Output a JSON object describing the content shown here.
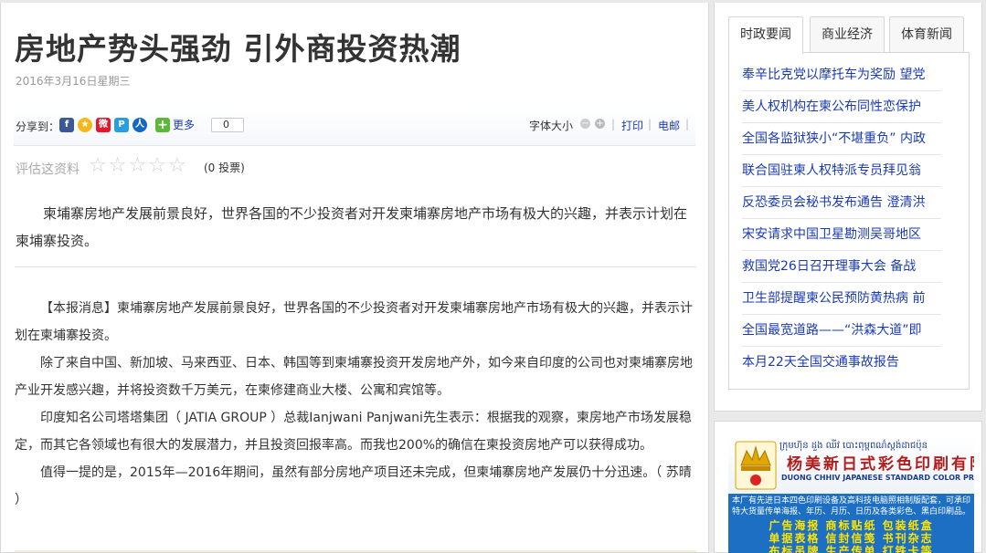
{
  "article": {
    "title": "房地产势头强劲 引外商投资热潮",
    "date": "2016年3月16日星期三",
    "share_label": "分享到：",
    "share_more": "更多",
    "share_count": "0",
    "font_size_label": "字体大小",
    "print_label": "打印",
    "email_label": "电邮",
    "rating_label": "评估这资料",
    "votes": "(0 投票)",
    "summary": "柬埔寨房地产发展前景良好，世界各国的不少投资者对开发柬埔寨房地产市场有极大的兴趣，并表示计划在柬埔寨投资。",
    "paragraphs": [
      "【本报消息】柬埔寨房地产发展前景良好，世界各国的不少投资者对开发柬埔寨房地产市场有极大的兴趣，并表示计划在柬埔寨投资。",
      "除了来自中国、新加坡、马来西亚、日本、韩国等到柬埔寨投资开发房地产外，如今来自印度的公司也对柬埔寨房地产业开发感兴趣，并将投资数千万美元，在柬修建商业大楼、公寓和宾馆等。",
      "印度知名公司塔塔集团（ JATIA GROUP ）总裁Ianjwani Panjwani先生表示：根据我的观察，柬房地产市场发展稳定，而其它各领域也有很大的发展潜力，并且投资回报率高。而我也200%的确信在柬投资房地产可以获得成功。",
      "值得一提的是，2015年—2016年期间，虽然有部分房地产项目还未完成，但柬埔寨房地产发展仍十分迅速。（ 苏晴 ）"
    ]
  },
  "sidebar": {
    "tabs": [
      "时政要闻",
      "商业经济",
      "体育新闻"
    ],
    "news": [
      "奉辛比克党以摩托车为奖励 望党",
      "美人权机构在柬公布同性恋保护",
      "全国各监狱狭小“不堪重负” 内政",
      "联合国驻柬人权特派专员拜见翁",
      "反恐委员会秘书发布通告 澄清洪",
      "宋安请求中国卫星勘测吴哥地区",
      "救国党26日召开理事大会 备战",
      "卫生部提醒柬公民预防黄热病 前",
      "全国最宽道路——“洪森大道”即",
      "本月22天全国交通事故报告"
    ]
  },
  "ad": {
    "khmer": "ក្រុមហ៊ុន ដួង ឈីវ បោះពុម្ពពណ៌ស្តង់ដាជប៉ុន",
    "cn_name": "杨美新日式彩色印刷有限公司",
    "en_name": "DUONG CHHIV JAPANESE STANDARD COLOR PRINTING CO.,LTD.",
    "desc": "本厂有先进日本四色印刷设备及高科技电脑照相制版配套，可承印特大货量传单海报、年历、月历、日历及各类彩色、黑白印刷品。",
    "services": [
      "广告海报 商标贴纸 包装纸盒",
      "单据表格 信封信笺 书刊杂志",
      "布标吊牌 生产传单 打铁卡等"
    ]
  },
  "colors": {
    "link": "#1a3bb3",
    "ad_blue": "#1c6fc2",
    "ad_red": "#b21c1c",
    "ad_yellow": "#ffe400"
  }
}
